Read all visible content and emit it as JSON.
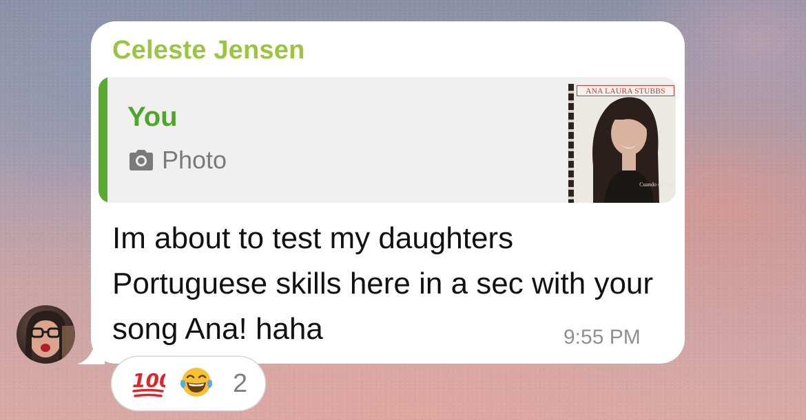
{
  "message": {
    "sender_name": "Celeste Jensen",
    "reply": {
      "author": "You",
      "type_label": "Photo",
      "type_icon": "camera-icon",
      "thumbnail": {
        "title_text": "ANA LAURA STUBBS",
        "caption_text": "Cuando se ama"
      }
    },
    "text": "Im about to test my daughters Portuguese skills here in a sec with your song Ana! haha",
    "time": "9:55 PM"
  },
  "reactions": {
    "items": [
      {
        "emoji": "hundred-points-emoji"
      },
      {
        "emoji": "face-with-tears-of-joy-emoji"
      }
    ],
    "count": "2"
  },
  "colors": {
    "sender_name": "#9bc43f",
    "reply_accent": "#5aaa32",
    "bubble": "#ffffff",
    "time": "#8e8e93"
  }
}
